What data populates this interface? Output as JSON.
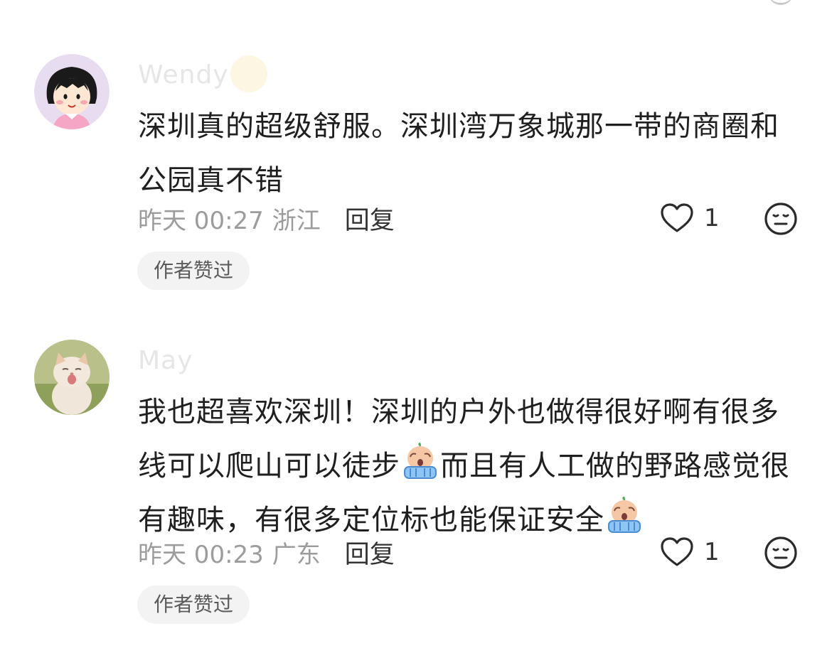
{
  "comments": [
    {
      "username": "Wendy",
      "text_parts": [
        "深圳真的超级舒服。深圳湾万象城那一带的商圈和公园真不错"
      ],
      "time": "昨天 00:27",
      "region": "浙江",
      "reply_label": "回复",
      "like_count": "1",
      "author_liked_label": "作者赞过",
      "avatar": "cartoon-girl-avatar"
    },
    {
      "username": "May",
      "text_parts": [
        "我也超喜欢深圳！深圳的户外也做得很好啊有很多线可以爬山可以徒步",
        "而且有人工做的野路感觉很有趣味，有很多定位标也能保证安全",
        ""
      ],
      "emoji": "crying-emoji",
      "time": "昨天 00:23",
      "region": "广东",
      "reply_label": "回复",
      "like_count": "1",
      "author_liked_label": "作者赞过",
      "avatar": "kitten-avatar"
    }
  ],
  "colors": {
    "text": "#1f1f1f",
    "meta": "#9c9c9c",
    "pill_bg": "#f3f3f3"
  }
}
